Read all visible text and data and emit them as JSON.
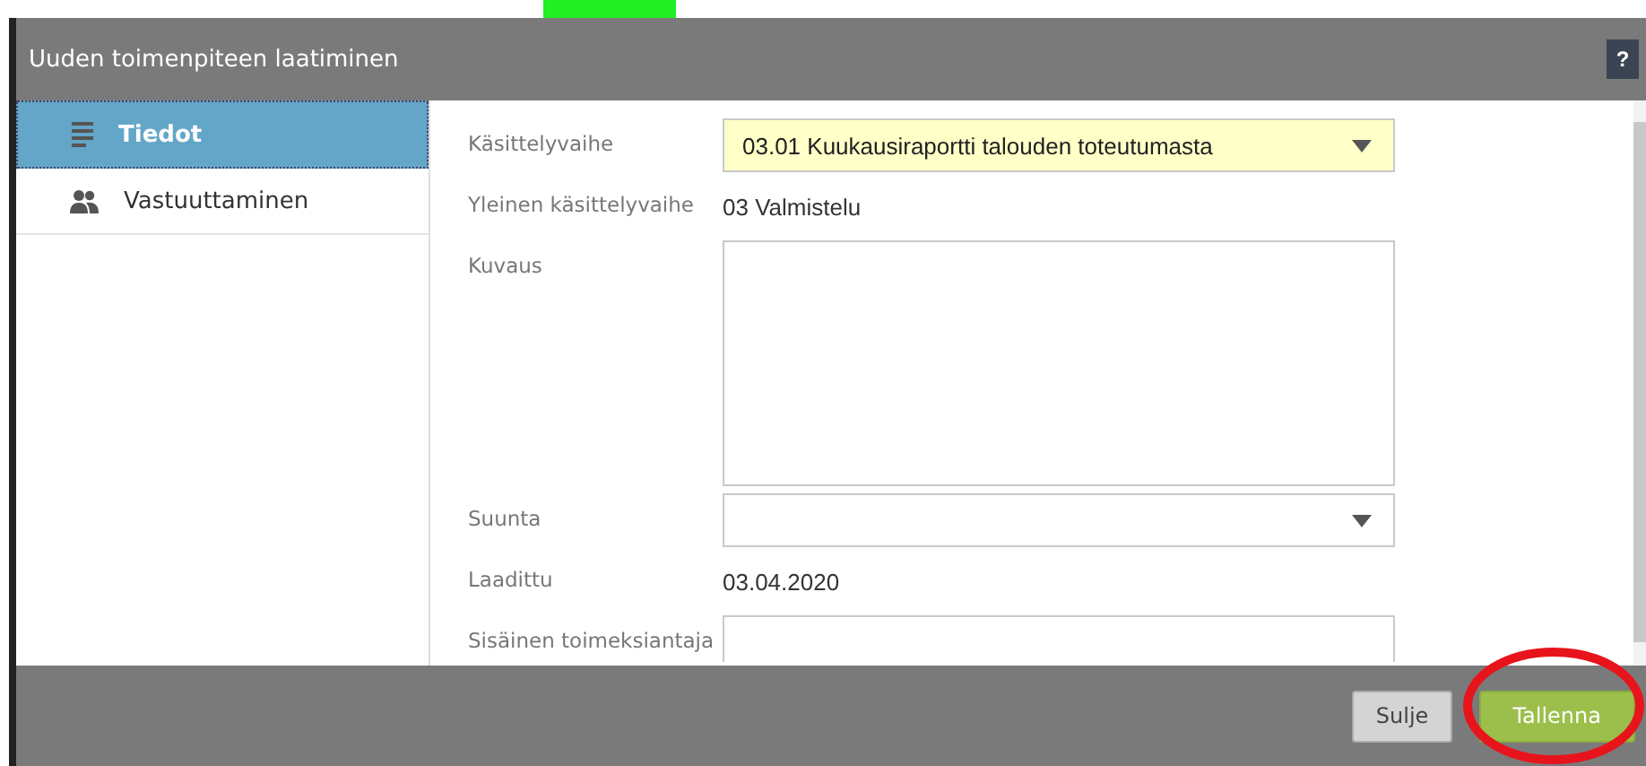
{
  "window": {
    "title": "Uuden toimenpiteen laatiminen",
    "help": "?"
  },
  "sidebar": {
    "items": [
      {
        "label": "Tiedot",
        "kind": "list",
        "selected": true
      },
      {
        "label": "Vastuuttaminen",
        "kind": "people",
        "selected": false
      }
    ]
  },
  "form": {
    "fields": [
      {
        "kind": "select",
        "label": "Käsittelyvaihe",
        "value": "03.01 Kuukausiraportti talouden toteutumasta",
        "highlighted": true
      },
      {
        "kind": "text",
        "label": "Yleinen käsittelyvaihe",
        "value": "03 Valmistelu"
      },
      {
        "kind": "textarea",
        "label": "Kuvaus"
      },
      {
        "kind": "select",
        "label": "Suunta",
        "highlighted": false
      },
      {
        "kind": "text",
        "label": "Laadittu",
        "value": "03.04.2020"
      },
      {
        "kind": "input",
        "label": "Sisäinen toimeksiantaja"
      }
    ]
  },
  "buttons": [
    {
      "label": "Sulje",
      "kind": "secondary"
    },
    {
      "label": "Tallenna",
      "kind": "primary"
    }
  ]
}
